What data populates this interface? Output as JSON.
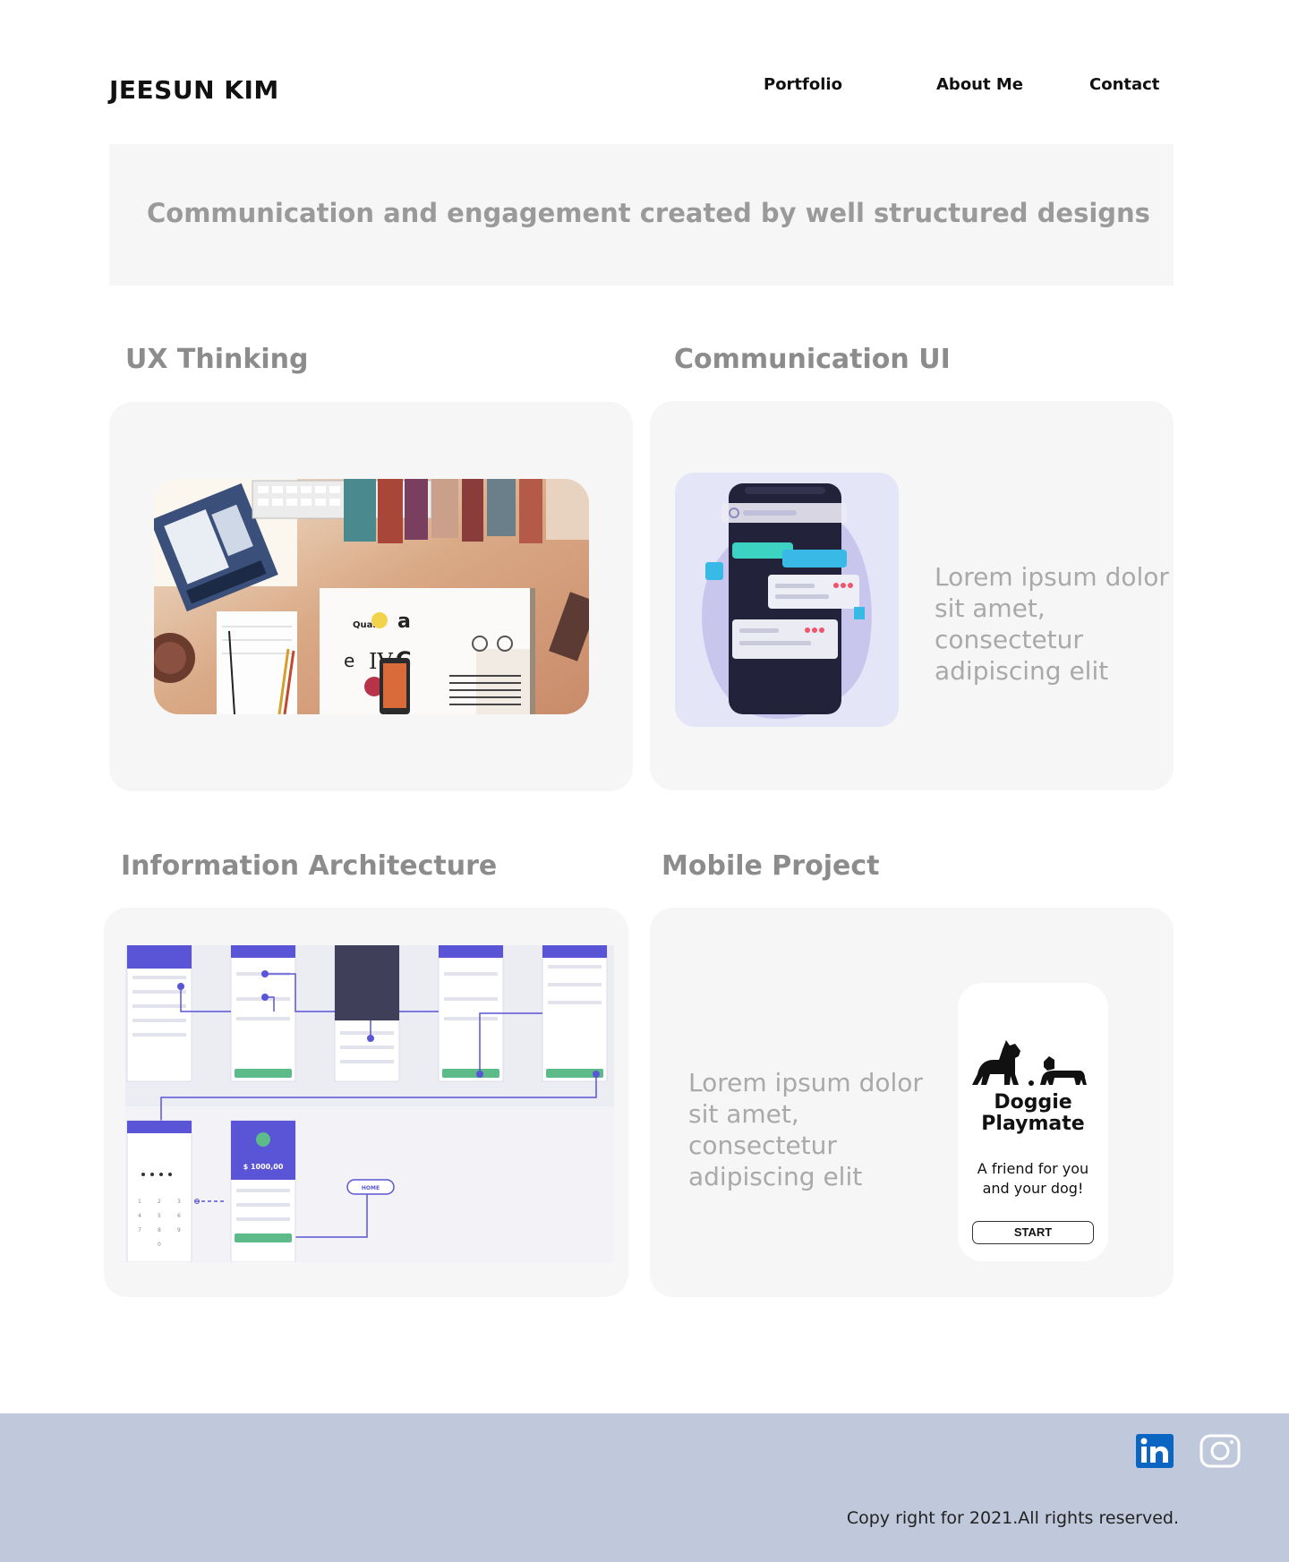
{
  "header": {
    "brand": "JEESUN KIM",
    "nav": [
      "Portfolio",
      "About Me",
      "Contact"
    ]
  },
  "hero": {
    "tagline": "Communication and engagement created by well structured designs"
  },
  "sections": [
    {
      "title": "UX Thinking"
    },
    {
      "title": "Communication UI",
      "text": "Lorem ipsum dolor sit amet, consectetur adipiscing elit",
      "text_lines": [
        "Lorem ipsum dolor",
        "sit amet,",
        "consectetur",
        "adipiscing elit"
      ]
    },
    {
      "title": "Information Architecture"
    },
    {
      "title": "Mobile Project",
      "text": "Lorem ipsum dolor sit amet, consectetur adipiscing elit",
      "text_lines": [
        "Lorem ipsum dolor",
        "sit amet,",
        "consectetur",
        "adipiscing elit"
      ]
    }
  ],
  "doggie": {
    "title_line1": "Doggie",
    "title_line2": "Playmate",
    "subtitle_line1": "A friend for you",
    "subtitle_line2": "and your dog!",
    "button": "START"
  },
  "ia_mock": {
    "amount": "$ 1000,00",
    "home_label": "HOME"
  },
  "footer": {
    "copyright": "Copy right for 2021.All rights reserved.",
    "social": [
      "linkedin-icon",
      "instagram-icon"
    ]
  },
  "colors": {
    "card_bg": "#f6f6f6",
    "footer_bg": "#bfc9db",
    "title_gray": "#8c8c8c",
    "text_gray": "#a9a9a9",
    "accent_purple": "#5a55d6",
    "accent_green": "#5dbb8a",
    "linkedin_blue": "#0a66c2"
  }
}
